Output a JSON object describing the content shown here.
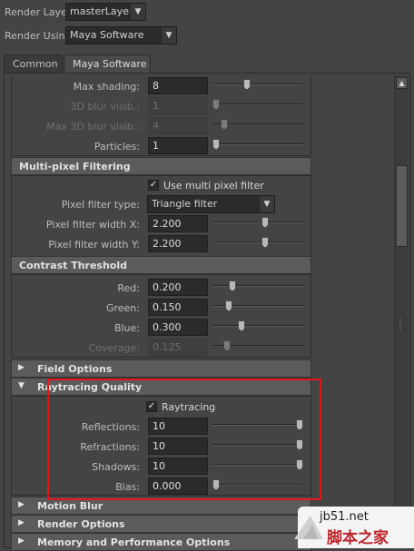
{
  "top": {
    "render_layer_label": "Render Layer",
    "render_layer_value": "masterLayer",
    "render_using_label": "Render Using",
    "render_using_value": "Maya Software"
  },
  "tabs": [
    {
      "label": "Common"
    },
    {
      "label": "Maya Software"
    }
  ],
  "motion_rows": [
    {
      "label": "Max shading:",
      "value": "8",
      "enabled": true,
      "level": 0.37
    },
    {
      "label": "3D blur visib.:",
      "value": "1",
      "enabled": false,
      "level": 0.0
    },
    {
      "label": "Max 3D blur visib.:",
      "value": "4",
      "enabled": false,
      "level": 0.1
    },
    {
      "label": "Particles:",
      "value": "1",
      "enabled": true,
      "level": 0.0
    }
  ],
  "multipixel": {
    "title": "Multi-pixel Filtering",
    "use_filter_label": "Use multi pixel filter",
    "use_filter_checked": true,
    "filter_type_label": "Pixel filter type:",
    "filter_type_value": "Triangle filter",
    "width_x_label": "Pixel filter width X:",
    "width_x_value": "2.200",
    "width_y_label": "Pixel filter width Y:",
    "width_y_value": "2.200"
  },
  "contrast": {
    "title": "Contrast Threshold",
    "rows": [
      {
        "label": "Red:",
        "value": "0.200",
        "enabled": true
      },
      {
        "label": "Green:",
        "value": "0.150",
        "enabled": true
      },
      {
        "label": "Blue:",
        "value": "0.300",
        "enabled": true
      },
      {
        "label": "Coverage:",
        "value": "0.125",
        "enabled": false
      }
    ]
  },
  "field_options": {
    "title": "Field Options"
  },
  "raytracing": {
    "title": "Raytracing Quality",
    "raytracing_label": "Raytracing",
    "raytracing_checked": true,
    "rows": [
      {
        "label": "Reflections:",
        "value": "10"
      },
      {
        "label": "Refractions:",
        "value": "10"
      },
      {
        "label": "Shadows:",
        "value": "10"
      },
      {
        "label": "Bias:",
        "value": "0.000"
      }
    ]
  },
  "collapsed_sections": [
    {
      "title": "Motion Blur"
    },
    {
      "title": "Render Options"
    },
    {
      "title": "Memory and Performance Options"
    }
  ],
  "watermark": {
    "site": "jb51.net",
    "cn": "脚本之家"
  },
  "colors": {
    "annotation": "#e4141a",
    "panel_bg": "#444444",
    "header_bg": "#5b5b5b"
  }
}
